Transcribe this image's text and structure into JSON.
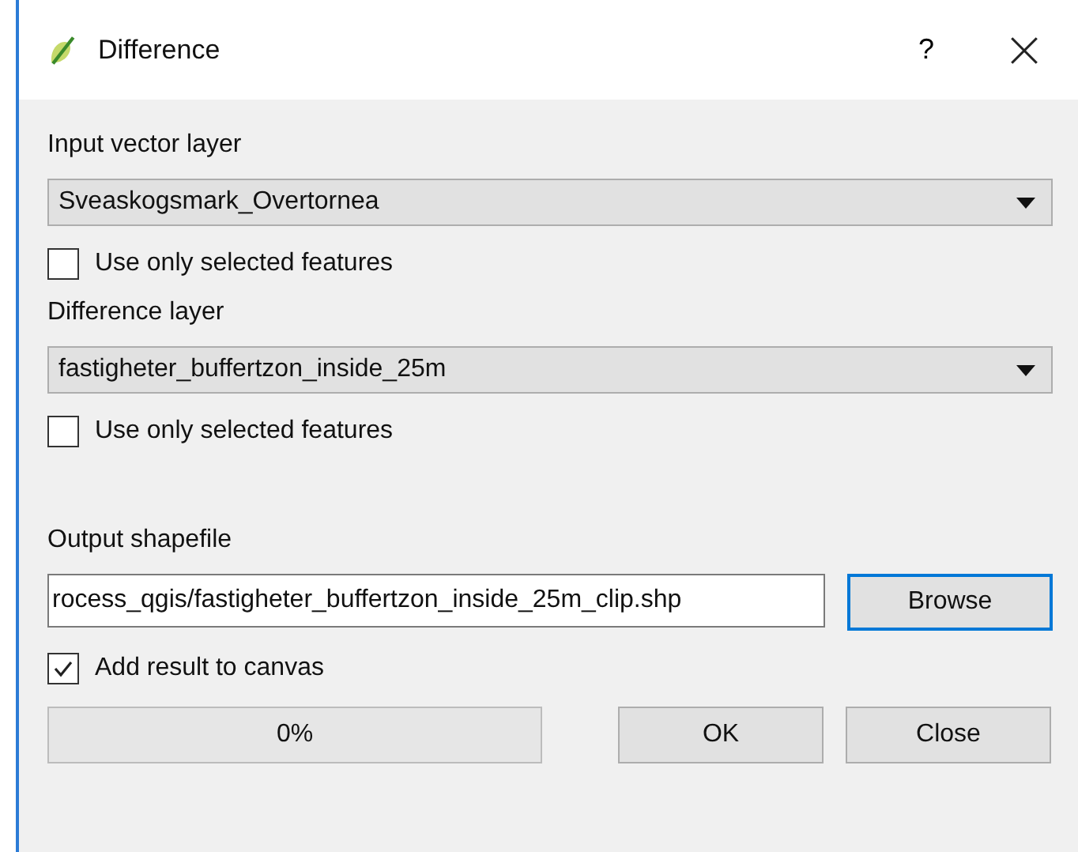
{
  "window": {
    "title": "Difference",
    "help": "?"
  },
  "input_layer": {
    "label": "Input vector layer",
    "value": "Sveaskogsmark_Overtornea",
    "use_selected": {
      "label": "Use only selected features",
      "checked": false
    }
  },
  "difference_layer": {
    "label": "Difference layer",
    "value": "fastigheter_buffertzon_inside_25m",
    "use_selected": {
      "label": "Use only selected features",
      "checked": false
    }
  },
  "output": {
    "label": "Output shapefile",
    "value": "rocess_qgis/fastigheter_buffertzon_inside_25m_clip.shp",
    "browse": "Browse"
  },
  "add_to_canvas": {
    "label": "Add result to canvas",
    "checked": true
  },
  "progress": {
    "text": "0%",
    "level": 0
  },
  "buttons": [
    "OK",
    "Close"
  ]
}
